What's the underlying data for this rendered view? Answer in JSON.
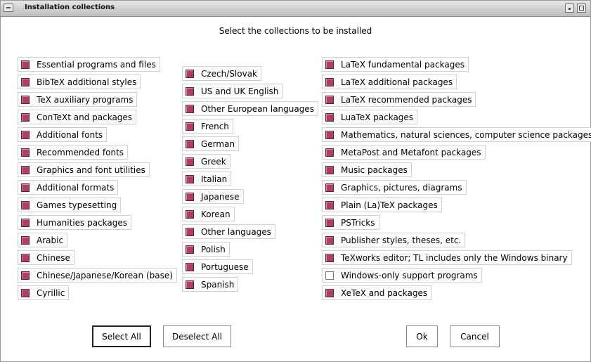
{
  "window": {
    "title": "Installation collections"
  },
  "heading": "Select the collections to be installed",
  "columns": [
    {
      "items": [
        {
          "label": "Essential programs and files",
          "checked": true
        },
        {
          "label": "BibTeX additional styles",
          "checked": true
        },
        {
          "label": "TeX auxiliary programs",
          "checked": true
        },
        {
          "label": "ConTeXt and packages",
          "checked": true
        },
        {
          "label": "Additional fonts",
          "checked": true
        },
        {
          "label": "Recommended fonts",
          "checked": true
        },
        {
          "label": "Graphics and font utilities",
          "checked": true
        },
        {
          "label": "Additional formats",
          "checked": true
        },
        {
          "label": "Games typesetting",
          "checked": true
        },
        {
          "label": "Humanities packages",
          "checked": true
        },
        {
          "label": "Arabic",
          "checked": true
        },
        {
          "label": "Chinese",
          "checked": true
        },
        {
          "label": "Chinese/Japanese/Korean (base)",
          "checked": true
        },
        {
          "label": "Cyrillic",
          "checked": true
        }
      ]
    },
    {
      "items": [
        {
          "label": "Czech/Slovak",
          "checked": true
        },
        {
          "label": "US and UK English",
          "checked": true
        },
        {
          "label": "Other European languages",
          "checked": true
        },
        {
          "label": "French",
          "checked": true
        },
        {
          "label": "German",
          "checked": true
        },
        {
          "label": "Greek",
          "checked": true
        },
        {
          "label": "Italian",
          "checked": true
        },
        {
          "label": "Japanese",
          "checked": true
        },
        {
          "label": "Korean",
          "checked": true
        },
        {
          "label": "Other languages",
          "checked": true
        },
        {
          "label": "Polish",
          "checked": true
        },
        {
          "label": "Portuguese",
          "checked": true
        },
        {
          "label": "Spanish",
          "checked": true
        }
      ]
    },
    {
      "items": [
        {
          "label": "LaTeX fundamental packages",
          "checked": true
        },
        {
          "label": "LaTeX additional packages",
          "checked": true
        },
        {
          "label": "LaTeX recommended packages",
          "checked": true
        },
        {
          "label": "LuaTeX packages",
          "checked": true
        },
        {
          "label": "Mathematics, natural sciences, computer science packages",
          "checked": true
        },
        {
          "label": "MetaPost and Metafont packages",
          "checked": true
        },
        {
          "label": "Music packages",
          "checked": true
        },
        {
          "label": "Graphics, pictures, diagrams",
          "checked": true
        },
        {
          "label": "Plain (La)TeX packages",
          "checked": true
        },
        {
          "label": "PSTricks",
          "checked": true
        },
        {
          "label": "Publisher styles, theses, etc.",
          "checked": true
        },
        {
          "label": "TeXworks editor; TL includes only the Windows binary",
          "checked": true
        },
        {
          "label": "Windows-only support programs",
          "checked": false
        },
        {
          "label": "XeTeX and packages",
          "checked": true
        }
      ]
    }
  ],
  "buttons": {
    "select_all": "Select All",
    "deselect_all": "Deselect All",
    "ok": "Ok",
    "cancel": "Cancel"
  },
  "colors": {
    "checkbox_checked": "#b03e62",
    "window_bg": "#ffffff",
    "titlebar": "#cfcfcf"
  }
}
